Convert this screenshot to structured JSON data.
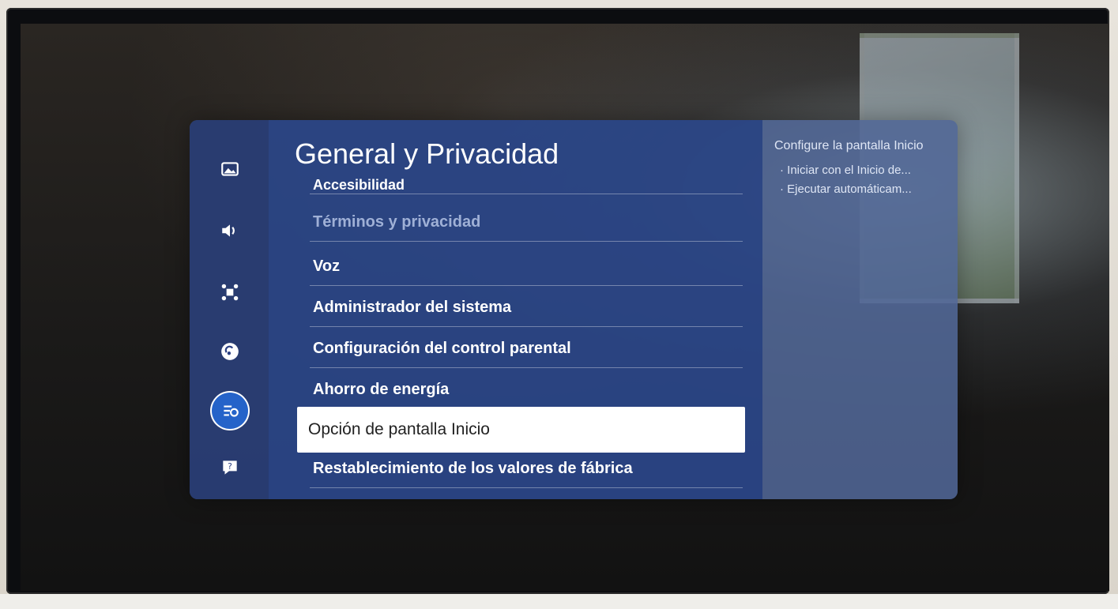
{
  "settings": {
    "title": "General y Privacidad",
    "menu_items": [
      {
        "label": "Accesibilidad"
      },
      {
        "label": "Términos y privacidad"
      },
      {
        "label": "Voz"
      },
      {
        "label": "Administrador del sistema"
      },
      {
        "label": "Configuración del control parental"
      },
      {
        "label": "Ahorro de energía"
      },
      {
        "label": "Opción de pantalla Inicio"
      },
      {
        "label": "Restablecimiento de los valores de fábrica"
      }
    ],
    "selected_item": "Opción de pantalla Inicio",
    "categories": [
      {
        "icon": "picture-icon"
      },
      {
        "icon": "sound-icon"
      },
      {
        "icon": "connection-icon"
      },
      {
        "icon": "broadcast-icon"
      },
      {
        "icon": "general-privacy-icon",
        "active": true
      },
      {
        "icon": "support-icon"
      }
    ]
  },
  "info_panel": {
    "title": "Configure la pantalla Inicio",
    "items": [
      "Iniciar con el Inicio de...",
      "Ejecutar automáticam..."
    ]
  },
  "colors": {
    "panel": "#2a3f82",
    "accent": "#2563c9",
    "selected_bg": "#ffffff"
  }
}
